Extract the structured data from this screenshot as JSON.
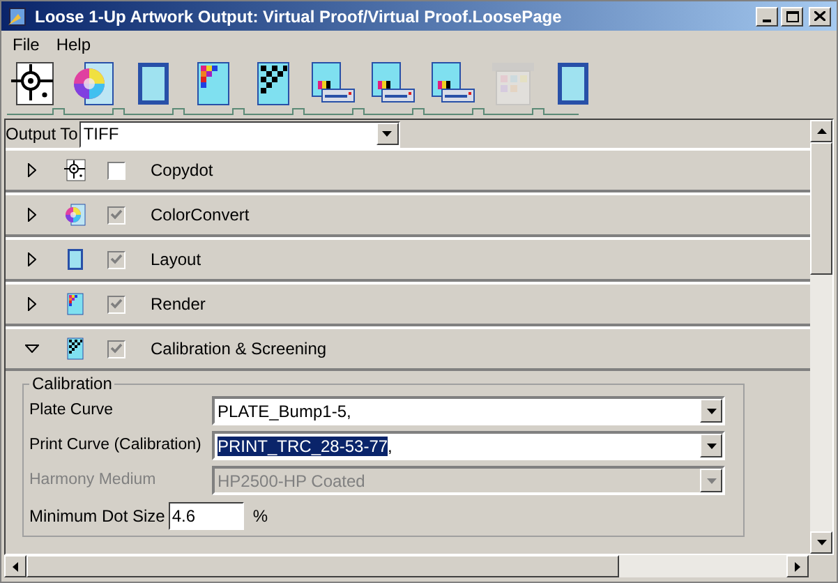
{
  "window": {
    "title": "Loose 1-Up Artwork Output: Virtual Proof/Virtual Proof.LoosePage"
  },
  "menu": [
    "File",
    "Help"
  ],
  "toolbar": [
    {
      "kind": "target",
      "disabled": false
    },
    {
      "kind": "colorwheel",
      "disabled": false
    },
    {
      "kind": "page",
      "disabled": false
    },
    {
      "kind": "render",
      "disabled": false
    },
    {
      "kind": "screening",
      "disabled": false
    },
    {
      "kind": "printer",
      "disabled": false
    },
    {
      "kind": "printer",
      "disabled": false
    },
    {
      "kind": "printer",
      "disabled": false
    },
    {
      "kind": "proofer",
      "disabled": true
    },
    {
      "kind": "page",
      "disabled": false
    }
  ],
  "output_to": {
    "label": "Output To",
    "value": "TIFF"
  },
  "sections": [
    {
      "kind": "target",
      "label": "Copydot",
      "expanded": false,
      "checked": false,
      "disabled": false
    },
    {
      "kind": "colorwheel",
      "label": "ColorConvert",
      "expanded": false,
      "checked": true,
      "disabled": true
    },
    {
      "kind": "page",
      "label": "Layout",
      "expanded": false,
      "checked": true,
      "disabled": true
    },
    {
      "kind": "render",
      "label": "Render",
      "expanded": false,
      "checked": true,
      "disabled": true
    },
    {
      "kind": "screening",
      "label": "Calibration & Screening",
      "expanded": true,
      "checked": true,
      "disabled": true
    }
  ],
  "calibration": {
    "title": "Calibration",
    "fields": [
      {
        "label": "Plate Curve",
        "value": "PLATE_Bump1-5,",
        "disabled": false
      },
      {
        "label": "Print Curve (Calibration)",
        "selected_text": "PRINT_TRC_28-53-77",
        "value": ",",
        "disabled": false
      },
      {
        "label": "Harmony Medium",
        "value": "HP2500-HP Coated",
        "disabled": true
      }
    ],
    "min_dot": {
      "label": "Minimum Dot Size",
      "value": "4.6",
      "unit": "%"
    }
  }
}
